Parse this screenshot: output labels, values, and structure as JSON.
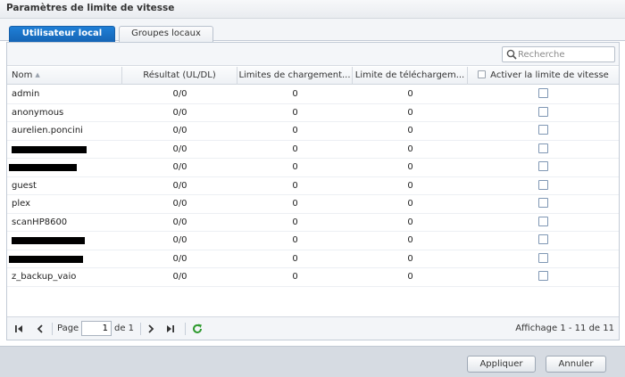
{
  "window": {
    "title": "Paramètres de limite de vitesse"
  },
  "tabs": [
    {
      "label": "Utilisateur local",
      "active": true
    },
    {
      "label": "Groupes locaux",
      "active": false
    }
  ],
  "search": {
    "placeholder": "Recherche",
    "icon": "search-icon"
  },
  "table": {
    "columns": {
      "name": "Nom",
      "result": "Résultat (UL/DL)",
      "upload": "Limites de chargement...",
      "download": "Limite de téléchargem...",
      "enable": "Activer la limite de vitesse"
    },
    "rows": [
      {
        "name": "admin",
        "result": "0/0",
        "upload": "0",
        "download": "0",
        "enabled": false
      },
      {
        "name": "anonymous",
        "result": "0/0",
        "upload": "0",
        "download": "0",
        "enabled": false
      },
      {
        "name": "aurelien.poncini",
        "result": "0/0",
        "upload": "0",
        "download": "0",
        "enabled": false
      },
      {
        "name": "",
        "result": "0/0",
        "upload": "0",
        "download": "0",
        "enabled": false
      },
      {
        "name": "",
        "result": "0/0",
        "upload": "0",
        "download": "0",
        "enabled": false
      },
      {
        "name": "guest",
        "result": "0/0",
        "upload": "0",
        "download": "0",
        "enabled": false
      },
      {
        "name": "plex",
        "result": "0/0",
        "upload": "0",
        "download": "0",
        "enabled": false
      },
      {
        "name": "scanHP8600",
        "result": "0/0",
        "upload": "0",
        "download": "0",
        "enabled": false
      },
      {
        "name": "",
        "result": "0/0",
        "upload": "0",
        "download": "0",
        "enabled": false
      },
      {
        "name": "",
        "result": "0/0",
        "upload": "0",
        "download": "0",
        "enabled": false
      },
      {
        "name": "z_backup_vaio",
        "result": "0/0",
        "upload": "0",
        "download": "0",
        "enabled": false
      }
    ]
  },
  "pager": {
    "page_label": "Page",
    "page_value": "1",
    "of_label": "de 1",
    "status": "Affichage 1 - 11 de 11"
  },
  "footer": {
    "apply": "Appliquer",
    "cancel": "Annuler"
  },
  "colors": {
    "accent": "#1a6fc4",
    "refresh": "#2e9a2e"
  }
}
